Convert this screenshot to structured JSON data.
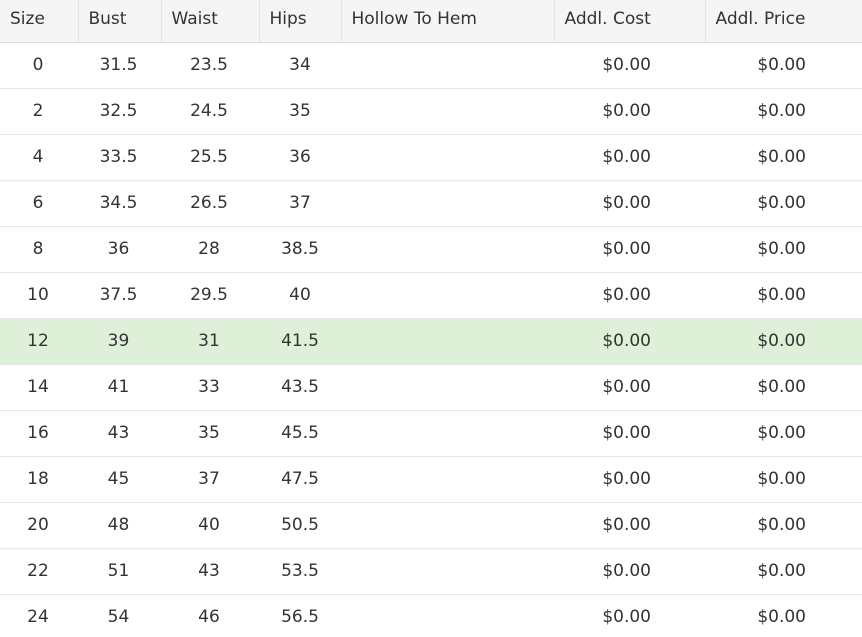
{
  "table": {
    "headers": {
      "size": "Size",
      "bust": "Bust",
      "waist": "Waist",
      "hips": "Hips",
      "hollow_to_hem": "Hollow To Hem",
      "addl_cost": "Addl. Cost",
      "addl_price": "Addl. Price"
    },
    "rows": [
      {
        "size": "0",
        "bust": "31.5",
        "waist": "23.5",
        "hips": "34",
        "hollow_to_hem": "",
        "addl_cost": "$0.00",
        "addl_price": "$0.00"
      },
      {
        "size": "2",
        "bust": "32.5",
        "waist": "24.5",
        "hips": "35",
        "hollow_to_hem": "",
        "addl_cost": "$0.00",
        "addl_price": "$0.00"
      },
      {
        "size": "4",
        "bust": "33.5",
        "waist": "25.5",
        "hips": "36",
        "hollow_to_hem": "",
        "addl_cost": "$0.00",
        "addl_price": "$0.00"
      },
      {
        "size": "6",
        "bust": "34.5",
        "waist": "26.5",
        "hips": "37",
        "hollow_to_hem": "",
        "addl_cost": "$0.00",
        "addl_price": "$0.00"
      },
      {
        "size": "8",
        "bust": "36",
        "waist": "28",
        "hips": "38.5",
        "hollow_to_hem": "",
        "addl_cost": "$0.00",
        "addl_price": "$0.00"
      },
      {
        "size": "10",
        "bust": "37.5",
        "waist": "29.5",
        "hips": "40",
        "hollow_to_hem": "",
        "addl_cost": "$0.00",
        "addl_price": "$0.00"
      },
      {
        "size": "12",
        "bust": "39",
        "waist": "31",
        "hips": "41.5",
        "hollow_to_hem": "",
        "addl_cost": "$0.00",
        "addl_price": "$0.00"
      },
      {
        "size": "14",
        "bust": "41",
        "waist": "33",
        "hips": "43.5",
        "hollow_to_hem": "",
        "addl_cost": "$0.00",
        "addl_price": "$0.00"
      },
      {
        "size": "16",
        "bust": "43",
        "waist": "35",
        "hips": "45.5",
        "hollow_to_hem": "",
        "addl_cost": "$0.00",
        "addl_price": "$0.00"
      },
      {
        "size": "18",
        "bust": "45",
        "waist": "37",
        "hips": "47.5",
        "hollow_to_hem": "",
        "addl_cost": "$0.00",
        "addl_price": "$0.00"
      },
      {
        "size": "20",
        "bust": "48",
        "waist": "40",
        "hips": "50.5",
        "hollow_to_hem": "",
        "addl_cost": "$0.00",
        "addl_price": "$0.00"
      },
      {
        "size": "22",
        "bust": "51",
        "waist": "43",
        "hips": "53.5",
        "hollow_to_hem": "",
        "addl_cost": "$0.00",
        "addl_price": "$0.00"
      },
      {
        "size": "24",
        "bust": "54",
        "waist": "46",
        "hips": "56.5",
        "hollow_to_hem": "",
        "addl_cost": "$0.00",
        "addl_price": "$0.00"
      }
    ],
    "highlight_color": "#dff0d8",
    "header_background": "#f5f5f5"
  }
}
